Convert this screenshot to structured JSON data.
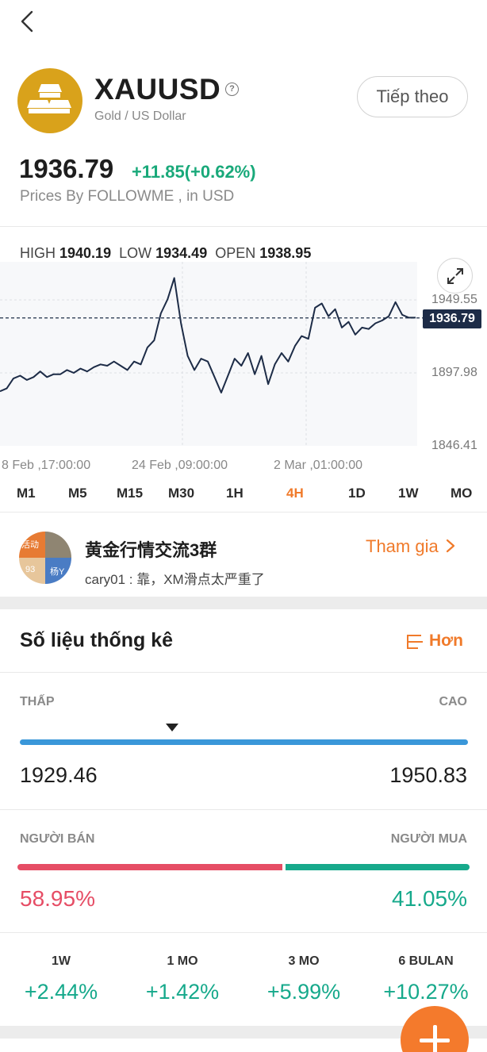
{
  "header": {
    "symbol": "XAUUSD",
    "name": "Gold / US Dollar",
    "follow_label": "Tiếp theo",
    "info_icon": "question-circle-icon",
    "back_icon": "chevron-left-icon",
    "logo_icon": "gold-bars-icon"
  },
  "quote": {
    "price": "1936.79",
    "change": "+11.85(+0.62%)",
    "source": "Prices By FOLLOWME , in USD"
  },
  "ohl": {
    "high_label": "HIGH",
    "high": "1940.19",
    "low_label": "LOW",
    "low": "1934.49",
    "open_label": "OPEN",
    "open": "1938.95"
  },
  "chart_data": {
    "type": "line",
    "title": "",
    "x_ticks": [
      "8 Feb ,17:00:00",
      "24 Feb ,09:00:00",
      "2 Mar ,01:00:00"
    ],
    "y_ticks": [
      1949.55,
      1897.98,
      1846.41
    ],
    "current_value": 1936.79,
    "current_label": "1936.79",
    "series": [
      {
        "values": [
          1885,
          1887,
          1894,
          1896,
          1893,
          1895,
          1899,
          1895,
          1897,
          1897,
          1900,
          1898,
          1901,
          1899,
          1902,
          1904,
          1903,
          1906,
          1903,
          1900,
          1906,
          1904,
          1916,
          1921,
          1940,
          1950,
          1965,
          1933,
          1910,
          1900,
          1908,
          1906,
          1895,
          1884,
          1896,
          1908,
          1903,
          1912,
          1897,
          1910,
          1890,
          1904,
          1912,
          1906,
          1917,
          1924,
          1922,
          1944,
          1947,
          1938,
          1943,
          1930,
          1934,
          1925,
          1930,
          1929,
          1933,
          1935,
          1938,
          1948,
          1939,
          1937,
          1937
        ]
      }
    ]
  },
  "timeframes": [
    {
      "label": "M1",
      "active": false
    },
    {
      "label": "M5",
      "active": false
    },
    {
      "label": "M15",
      "active": false
    },
    {
      "label": "M30",
      "active": false
    },
    {
      "label": "1H",
      "active": false
    },
    {
      "label": "4H",
      "active": true
    },
    {
      "label": "1D",
      "active": false
    },
    {
      "label": "1W",
      "active": false
    },
    {
      "label": "MO",
      "active": false
    }
  ],
  "group": {
    "name": "黄金行情交流3群",
    "last_message": "cary01 : 靠，XM滑点太严重了",
    "join_label": "Tham gia",
    "avatar_tags": [
      "活动",
      "93",
      "杨Y"
    ]
  },
  "stats": {
    "title": "Số liệu thống kê",
    "more_label": "Hơn",
    "low_label": "THẤP",
    "high_label": "CAO",
    "low_value": "1929.46",
    "high_value": "1950.83",
    "current_position_fraction": 0.34,
    "seller_label": "NGƯỜI BÁN",
    "buyer_label": "NGƯỜI MUA",
    "seller_pct": "58.95%",
    "buyer_pct": "41.05%",
    "seller_fraction": 0.5895,
    "performance": [
      {
        "label": "1W",
        "value": "+2.44%"
      },
      {
        "label": "1 MO",
        "value": "+1.42%"
      },
      {
        "label": "3 MO",
        "value": "+5.99%"
      },
      {
        "label": "6 BULAN",
        "value": "+10.27%"
      }
    ]
  },
  "colors": {
    "accent": "#f07a2a",
    "up": "#16a98b",
    "down": "#e64d65",
    "line": "#1d2c47",
    "gold": "#d9a21b"
  }
}
